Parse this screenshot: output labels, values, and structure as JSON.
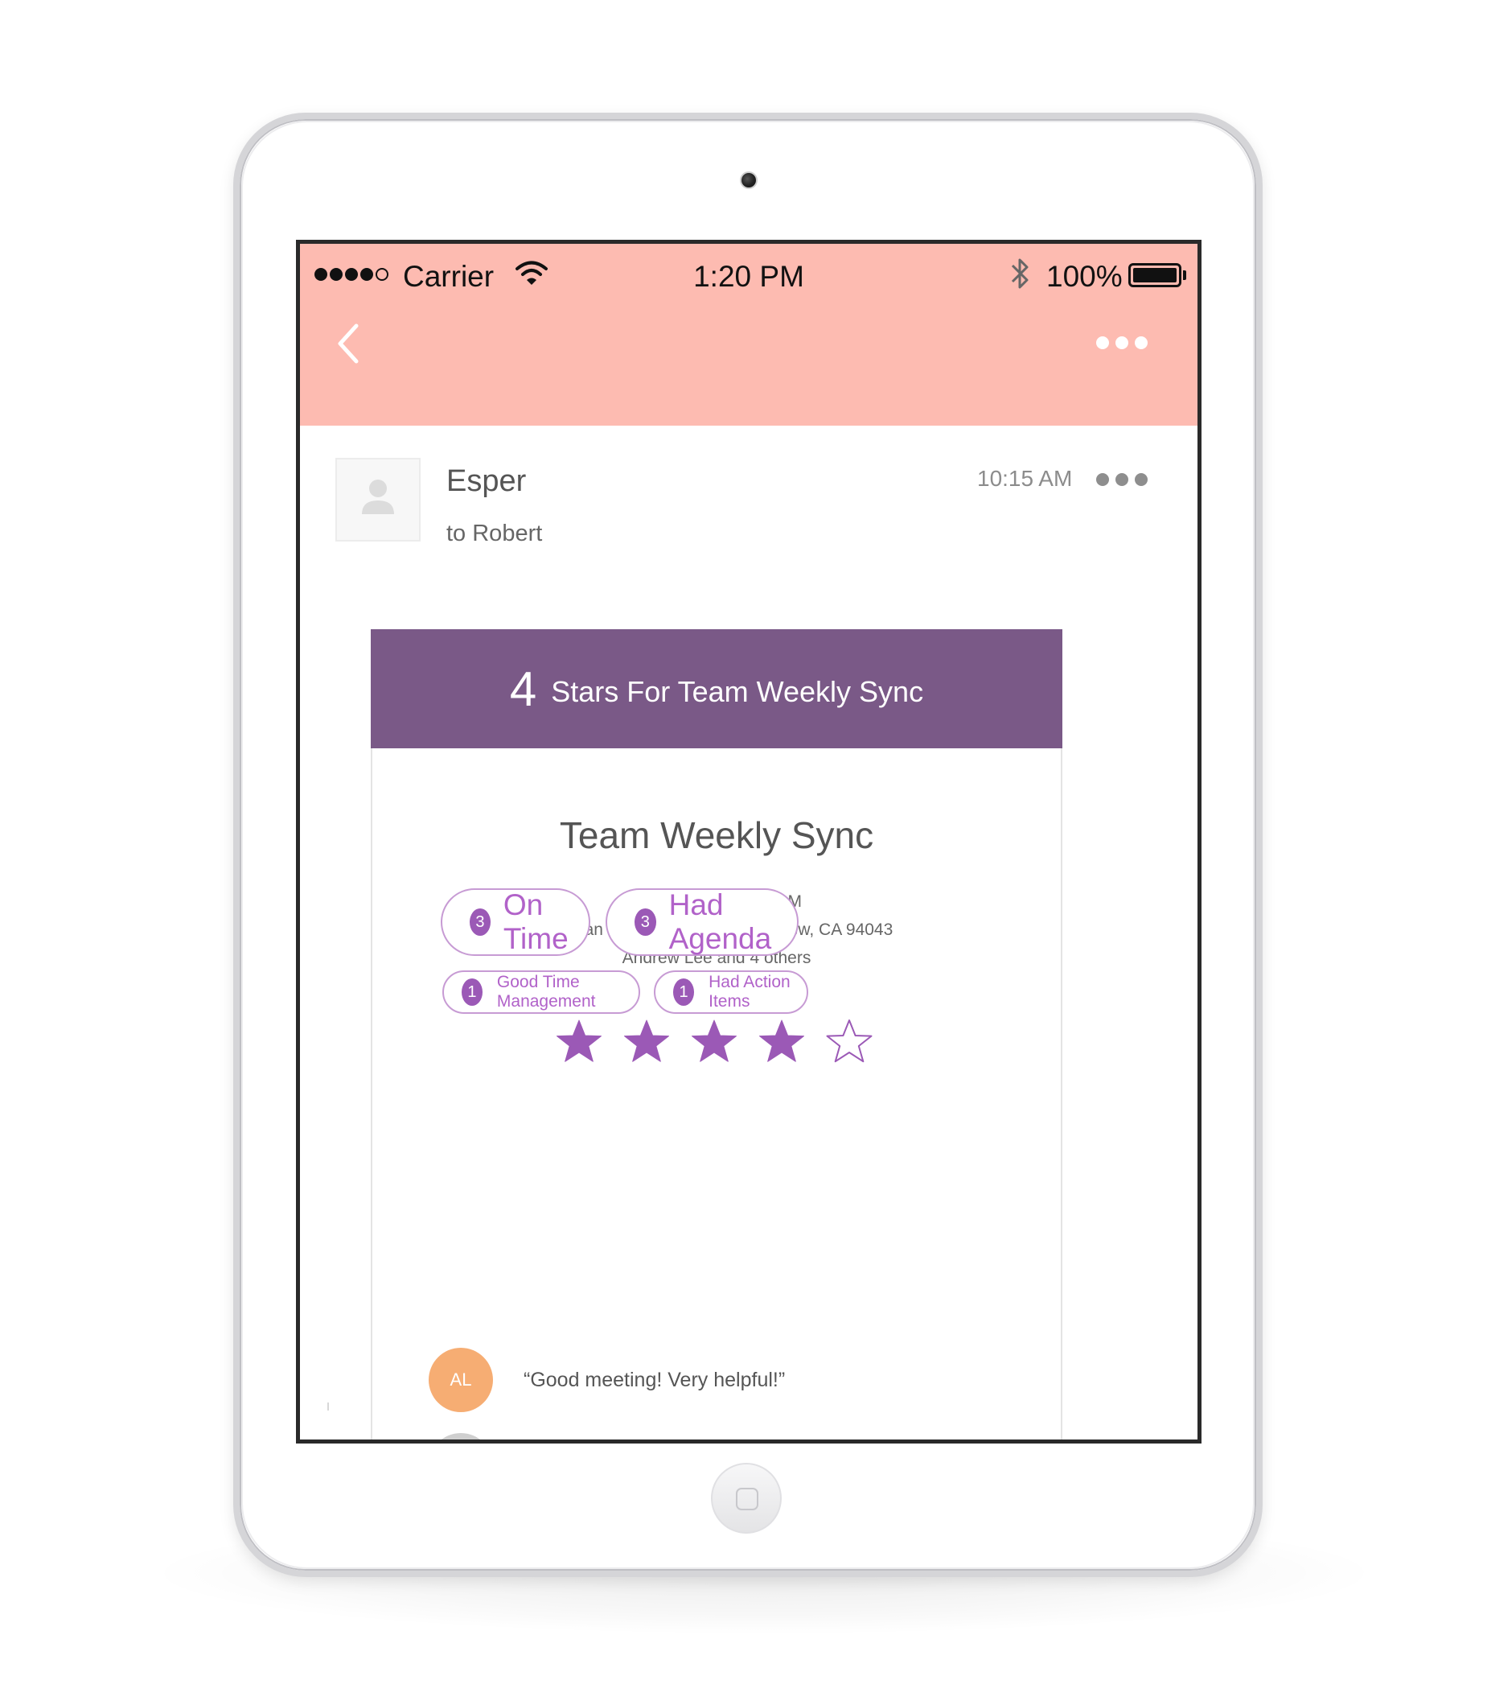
{
  "status_bar": {
    "carrier": "Carrier",
    "time": "1:20 PM",
    "battery": "100%",
    "signal_bars_filled": 4,
    "signal_bars_total": 5
  },
  "header": {
    "background_color": "#fdbbb1",
    "back_icon": "chevron-left-icon",
    "more_icon": "ellipsis-icon"
  },
  "email": {
    "sender": "Esper",
    "recipient": "to Robert",
    "time": "10:15 AM"
  },
  "card": {
    "banner_color": "#7a5987",
    "rating": "4",
    "banner_title": "Stars For Team Weekly Sync",
    "meeting_title": "Team Weekly Sync",
    "date": "Friday, July 7 at 10 AM",
    "address": "922 San Leandro St, Mountain View, CA 94043",
    "attendees": "Andrew Lee and 4 others",
    "stars_filled": 4,
    "stars_total": 5,
    "accent_color": "#9b59b6",
    "tags": [
      {
        "count": "3",
        "label": "On Time"
      },
      {
        "count": "3",
        "label": "Had Agenda"
      },
      {
        "count": "1",
        "label": "Good Time Management"
      },
      {
        "count": "1",
        "label": "Had Action Items"
      }
    ],
    "comments": [
      {
        "initials": "AL",
        "text": "“Good meeting! Very helpful!”",
        "avatar_color": "#f6ad73"
      }
    ]
  }
}
